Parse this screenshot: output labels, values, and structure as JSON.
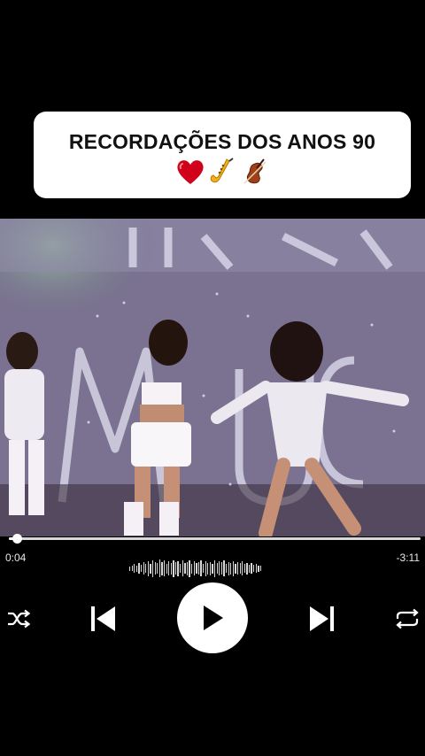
{
  "title_card": {
    "text": "RECORDAÇÕES DOS ANOS 90",
    "emojis": [
      "red-heart-emoji",
      "saxophone-emoji",
      "violin-emoji"
    ]
  },
  "video": {
    "backdrop_letters": "MUSICA",
    "description_colors": {
      "stage_bg": "#7c6f84",
      "sparkle": "#c9c6d8"
    }
  },
  "player": {
    "elapsed": "0:04",
    "remaining": "-3:11",
    "progress_fraction": 0.02,
    "waveform_levels": [
      0.25,
      0.3,
      0.5,
      0.35,
      0.6,
      0.4,
      0.7,
      0.5,
      0.85,
      0.55,
      0.95,
      0.7,
      0.6,
      1.0,
      0.75,
      0.9,
      0.55,
      0.8,
      0.65,
      0.95,
      0.7,
      0.85,
      0.5,
      0.9,
      0.6,
      0.75,
      0.95,
      0.55,
      0.8,
      0.6,
      0.7,
      0.9,
      0.5,
      0.85,
      0.65,
      0.75,
      0.55,
      0.95,
      0.6,
      0.8,
      0.7,
      0.9,
      0.5,
      0.75,
      0.65,
      0.85,
      0.55,
      0.7,
      0.6,
      0.8,
      0.5,
      0.65,
      0.45,
      0.6,
      0.4,
      0.5,
      0.35,
      0.3
    ],
    "controls": {
      "shuffle_icon": "shuffle-icon",
      "previous_icon": "skip-previous-icon",
      "play_icon": "play-icon",
      "next_icon": "skip-next-icon",
      "repeat_icon": "repeat-icon"
    },
    "accent": "#ffffff",
    "track_color": "#d8d8d8"
  }
}
